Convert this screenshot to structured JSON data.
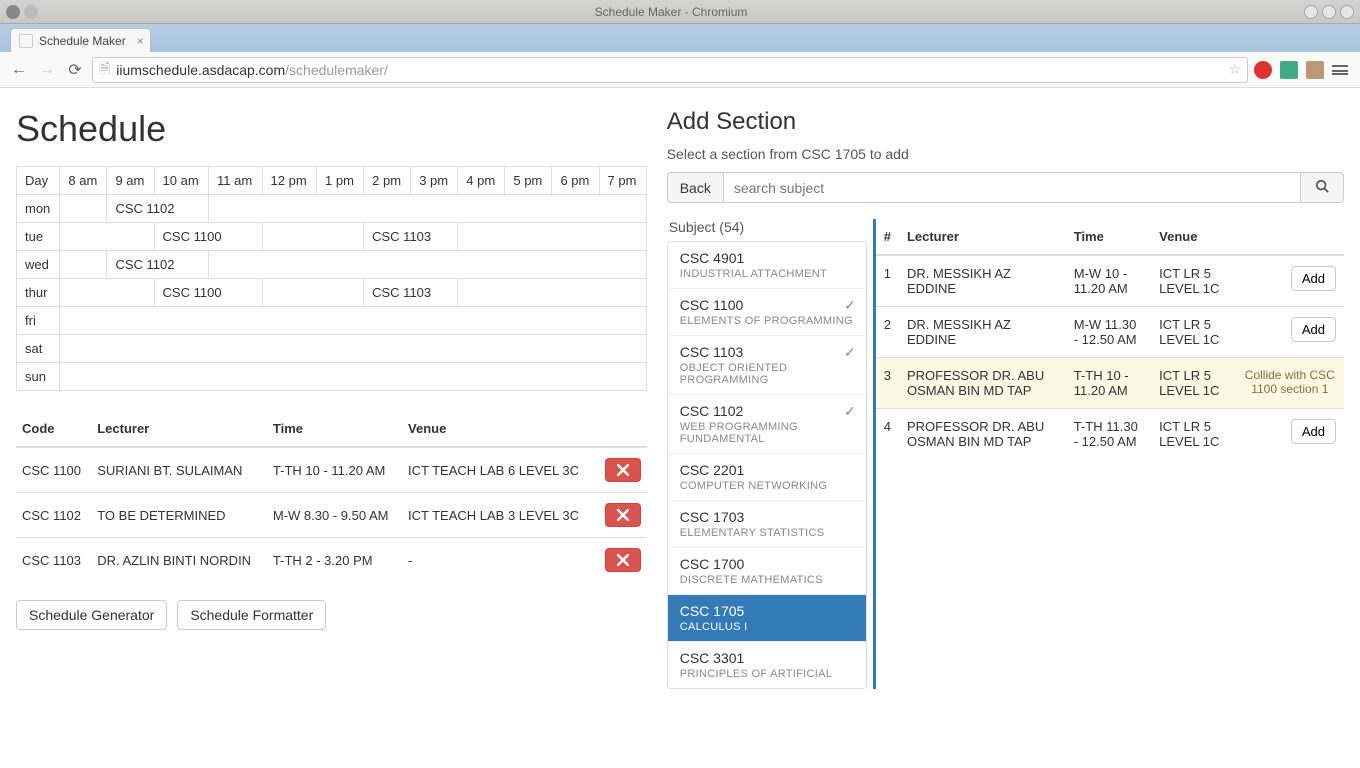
{
  "os": {
    "title": "Schedule Maker - Chromium"
  },
  "tab": {
    "title": "Schedule Maker",
    "close": "×"
  },
  "toolbar": {
    "url_origin": "iiumschedule.asdacap.com",
    "url_path": "/schedulemaker/"
  },
  "schedule": {
    "heading": "Schedule",
    "time_headers": [
      "Day",
      "8 am",
      "9 am",
      "10 am",
      "11 am",
      "12 pm",
      "1 pm",
      "2 pm",
      "3 pm",
      "4 pm",
      "5 pm",
      "6 pm",
      "7 pm"
    ],
    "rows": [
      {
        "day": "mon",
        "cells": [
          {
            "span": 1,
            "text": ""
          },
          {
            "span": 2,
            "text": "CSC 1102"
          },
          {
            "span": 10,
            "text": ""
          }
        ]
      },
      {
        "day": "tue",
        "cells": [
          {
            "span": 2,
            "text": ""
          },
          {
            "span": 2,
            "text": "CSC 1100"
          },
          {
            "span": 2,
            "text": ""
          },
          {
            "span": 2,
            "text": "CSC 1103"
          },
          {
            "span": 5,
            "text": ""
          }
        ]
      },
      {
        "day": "wed",
        "cells": [
          {
            "span": 1,
            "text": ""
          },
          {
            "span": 2,
            "text": "CSC 1102"
          },
          {
            "span": 10,
            "text": ""
          }
        ]
      },
      {
        "day": "thur",
        "cells": [
          {
            "span": 2,
            "text": ""
          },
          {
            "span": 2,
            "text": "CSC 1100"
          },
          {
            "span": 2,
            "text": ""
          },
          {
            "span": 2,
            "text": "CSC 1103"
          },
          {
            "span": 5,
            "text": ""
          }
        ]
      },
      {
        "day": "fri",
        "cells": [
          {
            "span": 13,
            "text": ""
          }
        ]
      },
      {
        "day": "sat",
        "cells": [
          {
            "span": 13,
            "text": ""
          }
        ]
      },
      {
        "day": "sun",
        "cells": [
          {
            "span": 13,
            "text": ""
          }
        ]
      }
    ]
  },
  "detail": {
    "headers": [
      "Code",
      "Lecturer",
      "Time",
      "Venue",
      ""
    ],
    "rows": [
      {
        "code": "CSC 1100",
        "lecturer": "SURIANI BT. SULAIMAN",
        "time": "T-TH 10 - 11.20 AM",
        "venue": "ICT TEACH LAB 6 LEVEL 3C"
      },
      {
        "code": "CSC 1102",
        "lecturer": "TO BE DETERMINED",
        "time": "M-W 8.30 - 9.50 AM",
        "venue": "ICT TEACH LAB 3 LEVEL 3C"
      },
      {
        "code": "CSC 1103",
        "lecturer": "DR. AZLIN BINTI NORDIN",
        "time": "T-TH 2 - 3.20 PM",
        "venue": "-"
      }
    ]
  },
  "buttons": {
    "generator": "Schedule Generator",
    "formatter": "Schedule Formatter"
  },
  "addsection": {
    "heading": "Add Section",
    "subtitle": "Select a section from CSC 1705 to add",
    "back": "Back",
    "search_placeholder": "search subject",
    "subject_header": "Subject (54)",
    "subjects": [
      {
        "code": "CSC 4901",
        "name": "INDUSTRIAL ATTACHMENT",
        "checked": false,
        "active": false
      },
      {
        "code": "CSC 1100",
        "name": "ELEMENTS OF PROGRAMMING",
        "checked": true,
        "active": false
      },
      {
        "code": "CSC 1103",
        "name": "OBJECT ORIENTED PROGRAMMING",
        "checked": true,
        "active": false
      },
      {
        "code": "CSC 1102",
        "name": "WEB PROGRAMMING FUNDAMENTAL",
        "checked": true,
        "active": false
      },
      {
        "code": "CSC 2201",
        "name": "COMPUTER NETWORKING",
        "checked": false,
        "active": false
      },
      {
        "code": "CSC 1703",
        "name": "ELEMENTARY STATISTICS",
        "checked": false,
        "active": false
      },
      {
        "code": "CSC 1700",
        "name": "DISCRETE MATHEMATICS",
        "checked": false,
        "active": false
      },
      {
        "code": "CSC 1705",
        "name": "CALCULUS I",
        "checked": false,
        "active": true
      },
      {
        "code": "CSC 3301",
        "name": "PRINCIPLES OF ARTIFICIAL",
        "checked": false,
        "active": false
      }
    ],
    "section_headers": [
      "#",
      "Lecturer",
      "Time",
      "Venue",
      ""
    ],
    "sections": [
      {
        "num": "1",
        "lecturer": "DR. MESSIKH AZ EDDINE",
        "time": "M-W 10 - 11.20 AM",
        "venue": "ICT LR 5 LEVEL 1C",
        "action": "Add",
        "warn": false,
        "note": ""
      },
      {
        "num": "2",
        "lecturer": "DR. MESSIKH AZ EDDINE",
        "time": "M-W 11.30 - 12.50 AM",
        "venue": "ICT LR 5 LEVEL 1C",
        "action": "Add",
        "warn": false,
        "note": ""
      },
      {
        "num": "3",
        "lecturer": "PROFESSOR DR. ABU OSMAN BIN MD TAP",
        "time": "T-TH 10 - 11.20 AM",
        "venue": "ICT LR 5 LEVEL 1C",
        "action": "",
        "warn": true,
        "note": "Collide with CSC 1100 section 1"
      },
      {
        "num": "4",
        "lecturer": "PROFESSOR DR. ABU OSMAN BIN MD TAP",
        "time": "T-TH 11.30 - 12.50 AM",
        "venue": "ICT LR 5 LEVEL 1C",
        "action": "Add",
        "warn": false,
        "note": ""
      }
    ]
  }
}
